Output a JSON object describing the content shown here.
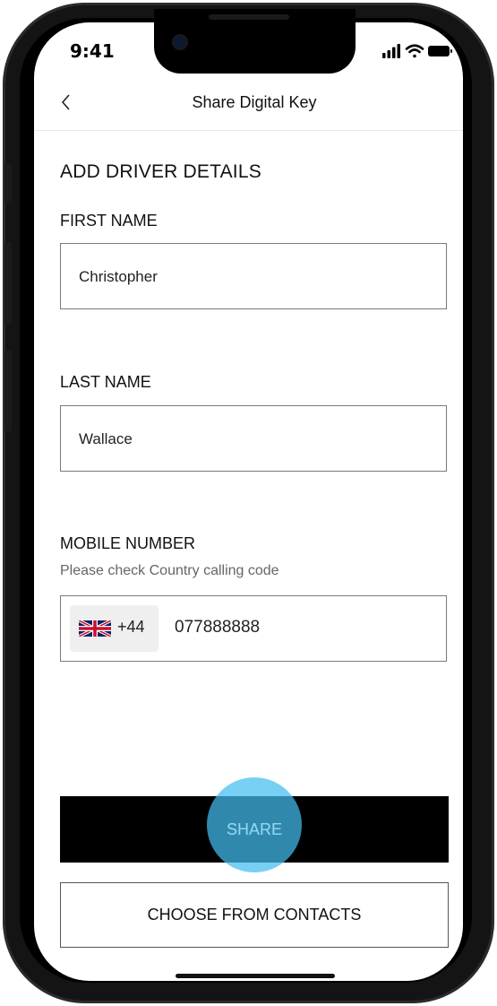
{
  "status": {
    "time": "9:41"
  },
  "nav": {
    "title": "Share Digital Key"
  },
  "form": {
    "section_title": "ADD DRIVER DETAILS",
    "first_name": {
      "label": "FIRST NAME",
      "value": "Christopher"
    },
    "last_name": {
      "label": "LAST NAME",
      "value": "Wallace"
    },
    "mobile": {
      "label": "MOBILE NUMBER",
      "hint": "Please check Country calling code",
      "country_code": "+44",
      "flag_icon": "uk-flag-icon",
      "value": "077888888"
    }
  },
  "actions": {
    "share_label": "SHARE",
    "contacts_label": "CHOOSE FROM CONTACTS"
  },
  "colors": {
    "accent_touch": "#43bef0",
    "primary_button": "#000000"
  }
}
